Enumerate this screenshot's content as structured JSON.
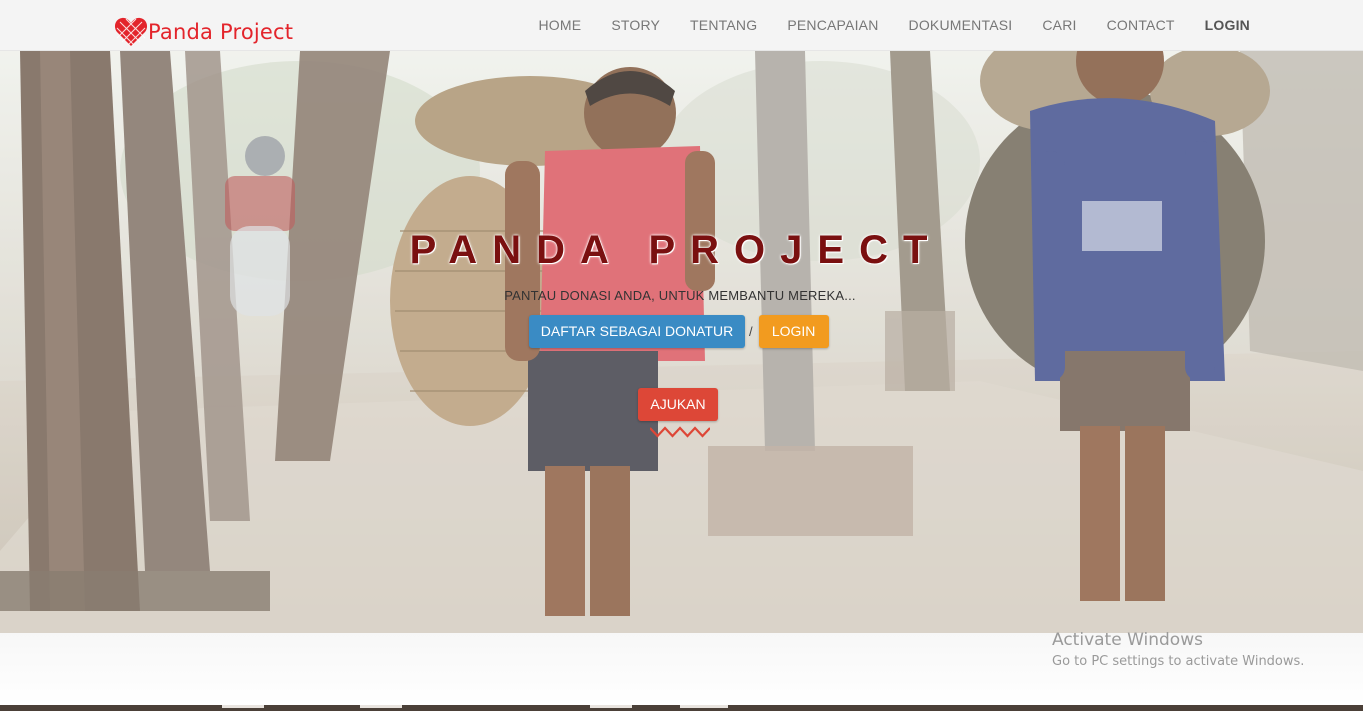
{
  "brand": {
    "name": "Panda Project",
    "color": "#e3242b",
    "logo_icon": "heart-icon"
  },
  "nav": {
    "items": [
      {
        "label": "HOME"
      },
      {
        "label": "STORY"
      },
      {
        "label": "TENTANG"
      },
      {
        "label": "PENCAPAIAN"
      },
      {
        "label": "DOKUMENTASI"
      },
      {
        "label": "CARI"
      },
      {
        "label": "CONTACT"
      },
      {
        "label": "LOGIN"
      }
    ]
  },
  "hero": {
    "title": "PANDA PROJECT",
    "subtitle": "PANTAU DONASI ANDA, UNTUK MEMBANTU MEREKA...",
    "register_button": "DAFTAR SEBAGAI DONATUR",
    "separator": "/",
    "login_button": "LOGIN",
    "submit_button": "AJUKAN",
    "colors": {
      "register": "#3a8bc4",
      "login": "#f29b1f",
      "submit": "#dd4737"
    }
  },
  "watermark": {
    "line1": "Activate Windows",
    "line2": "Go to PC settings to activate Windows."
  }
}
